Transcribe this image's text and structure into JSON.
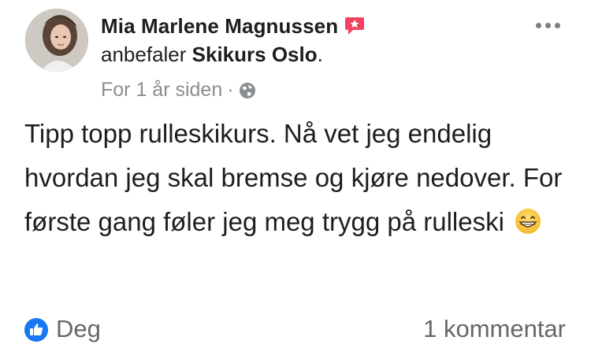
{
  "post": {
    "author_name": "Mia Marlene Magnussen",
    "recommends_text": "anbefaler",
    "page_name": "Skikurs Oslo",
    "page_suffix": ".",
    "timestamp": "For 1 år siden",
    "separator": "·",
    "privacy_icon": "globe-icon",
    "body": "Tipp topp rulleskikurs. Nå vet jeg endelig hvordan jeg skal bremse og kjøre nedover. For første gang føler jeg meg trygg på rulleski",
    "emoji": "grinning-face-icon"
  },
  "footer": {
    "reaction_icon": "thumbs-up-icon",
    "reaction_label": "Deg",
    "comment_count_label": "1 kommentar"
  },
  "colors": {
    "accent_blue": "#1877f2",
    "recommend_red": "#f3425f",
    "muted_text": "#65676b"
  }
}
